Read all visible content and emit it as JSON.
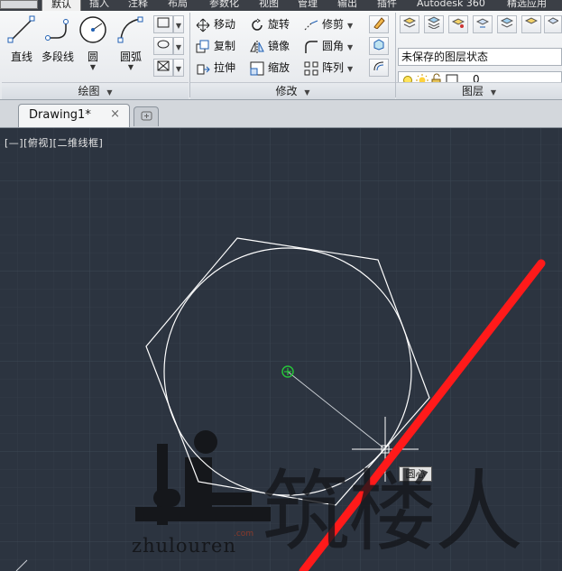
{
  "ribbon_tabs": {
    "active": "默认",
    "items": [
      "插入",
      "注释",
      "布局",
      "参数化",
      "视图",
      "管理",
      "输出",
      "插件",
      "Autodesk 360",
      "精选应用"
    ]
  },
  "draw_panel": {
    "title": "绘图",
    "line": "直线",
    "polyline": "多段线",
    "circle": "圆",
    "arc": "圆弧"
  },
  "modify_panel": {
    "title": "修改",
    "move": "移动",
    "rotate": "旋转",
    "trim": "修剪",
    "copy": "复制",
    "mirror": "镜像",
    "fillet": "圆角",
    "stretch": "拉伸",
    "scale": "缩放",
    "array": "阵列"
  },
  "layer_panel": {
    "title": "图层",
    "state": "未保存的图层状态",
    "current_layer": "0"
  },
  "document": {
    "tab_name": "Drawing1*",
    "close_glyph": "×"
  },
  "viewport": {
    "label": "[—][俯视][二维线框]",
    "osnap_tip": "圆心"
  },
  "watermark": {
    "brand_cn": "筑楼人",
    "brand_en": "zhulouren",
    "domain": ".com"
  },
  "colors": {
    "canvas": "#2c3440",
    "grid": "#36404c",
    "red_line": "#ff1a1a",
    "hex_circle": "#ffffff"
  }
}
